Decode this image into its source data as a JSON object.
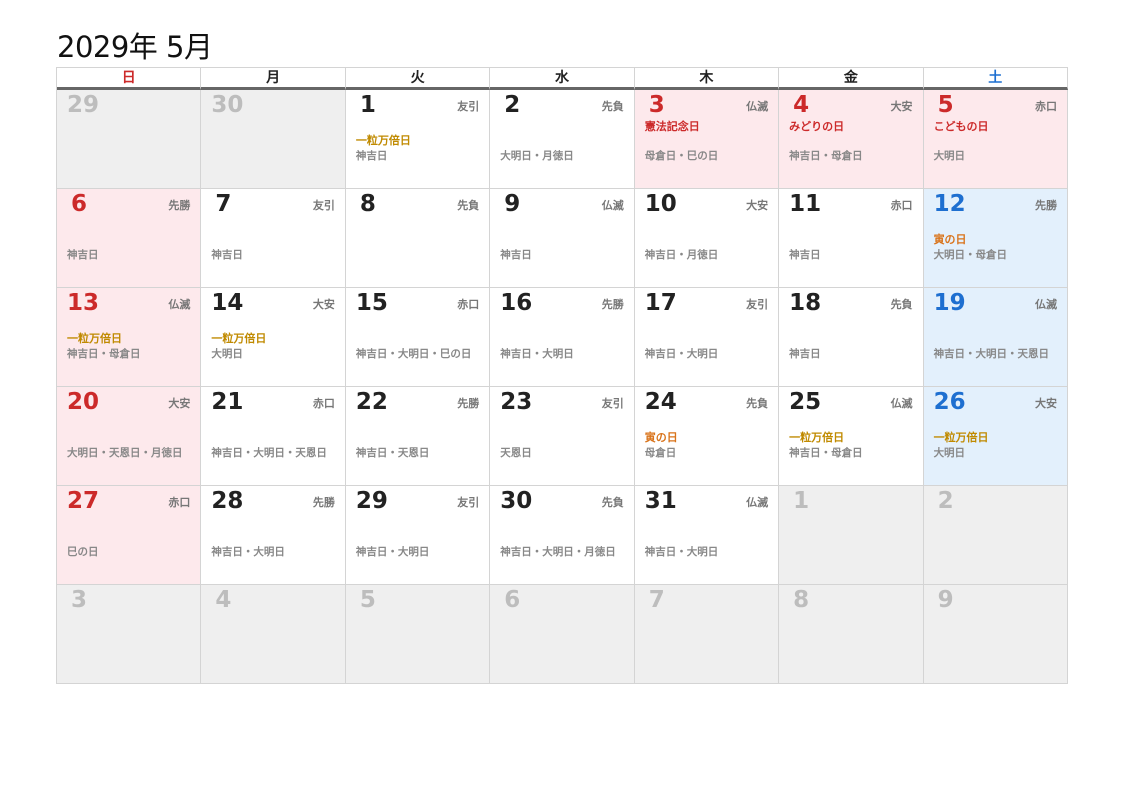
{
  "title": "2029年 5月",
  "weekdays": [
    "日",
    "月",
    "火",
    "水",
    "木",
    "金",
    "土"
  ],
  "colors": {
    "sunday": "#cc2a2a",
    "saturday": "#1e6fd0",
    "holiday_bg": "#fde9ec",
    "saturday_bg": "#e3f0fc",
    "other_month_bg": "#efefef",
    "ichiryu": "#c08a00",
    "tora": "#d9731a"
  },
  "weeks": [
    [
      {
        "day": "29",
        "rokuyo": "",
        "event": "",
        "notes": "",
        "kind": "other"
      },
      {
        "day": "30",
        "rokuyo": "",
        "event": "",
        "notes": "",
        "kind": "other"
      },
      {
        "day": "1",
        "rokuyo": "友引",
        "event": "一粒万倍日",
        "event_type": "gold",
        "notes": "神吉日",
        "kind": "normal"
      },
      {
        "day": "2",
        "rokuyo": "先負",
        "event": "",
        "notes": "大明日・月徳日",
        "kind": "normal"
      },
      {
        "day": "3",
        "rokuyo": "仏滅",
        "event": "憲法記念日",
        "event_type": "hname",
        "notes": "母倉日・巳の日",
        "kind": "holiday"
      },
      {
        "day": "4",
        "rokuyo": "大安",
        "event": "みどりの日",
        "event_type": "hname",
        "notes": "神吉日・母倉日",
        "kind": "holiday"
      },
      {
        "day": "5",
        "rokuyo": "赤口",
        "event": "こどもの日",
        "event_type": "hname",
        "notes": "大明日",
        "kind": "holiday"
      }
    ],
    [
      {
        "day": "6",
        "rokuyo": "先勝",
        "event": "",
        "notes": "神吉日",
        "kind": "holiday"
      },
      {
        "day": "7",
        "rokuyo": "友引",
        "event": "",
        "notes": "神吉日",
        "kind": "normal"
      },
      {
        "day": "8",
        "rokuyo": "先負",
        "event": "",
        "notes": "",
        "kind": "normal"
      },
      {
        "day": "9",
        "rokuyo": "仏滅",
        "event": "",
        "notes": "神吉日",
        "kind": "normal"
      },
      {
        "day": "10",
        "rokuyo": "大安",
        "event": "",
        "notes": "神吉日・月徳日",
        "kind": "normal"
      },
      {
        "day": "11",
        "rokuyo": "赤口",
        "event": "",
        "notes": "神吉日",
        "kind": "normal"
      },
      {
        "day": "12",
        "rokuyo": "先勝",
        "event": "寅の日",
        "event_type": "tora",
        "notes": "大明日・母倉日",
        "kind": "sat"
      }
    ],
    [
      {
        "day": "13",
        "rokuyo": "仏滅",
        "event": "一粒万倍日",
        "event_type": "gold",
        "notes": "神吉日・母倉日",
        "kind": "sun"
      },
      {
        "day": "14",
        "rokuyo": "大安",
        "event": "一粒万倍日",
        "event_type": "gold",
        "notes": "大明日",
        "kind": "normal"
      },
      {
        "day": "15",
        "rokuyo": "赤口",
        "event": "",
        "notes": "神吉日・大明日・巳の日",
        "kind": "normal"
      },
      {
        "day": "16",
        "rokuyo": "先勝",
        "event": "",
        "notes": "神吉日・大明日",
        "kind": "normal"
      },
      {
        "day": "17",
        "rokuyo": "友引",
        "event": "",
        "notes": "神吉日・大明日",
        "kind": "normal"
      },
      {
        "day": "18",
        "rokuyo": "先負",
        "event": "",
        "notes": "神吉日",
        "kind": "normal"
      },
      {
        "day": "19",
        "rokuyo": "仏滅",
        "event": "",
        "notes": "神吉日・大明日・天恩日",
        "kind": "sat"
      }
    ],
    [
      {
        "day": "20",
        "rokuyo": "大安",
        "event": "",
        "notes": "大明日・天恩日・月徳日",
        "kind": "sun"
      },
      {
        "day": "21",
        "rokuyo": "赤口",
        "event": "",
        "notes": "神吉日・大明日・天恩日",
        "kind": "normal"
      },
      {
        "day": "22",
        "rokuyo": "先勝",
        "event": "",
        "notes": "神吉日・天恩日",
        "kind": "normal"
      },
      {
        "day": "23",
        "rokuyo": "友引",
        "event": "",
        "notes": "天恩日",
        "kind": "normal"
      },
      {
        "day": "24",
        "rokuyo": "先負",
        "event": "寅の日",
        "event_type": "tora",
        "notes": "母倉日",
        "kind": "normal"
      },
      {
        "day": "25",
        "rokuyo": "仏滅",
        "event": "一粒万倍日",
        "event_type": "gold",
        "notes": "神吉日・母倉日",
        "kind": "normal"
      },
      {
        "day": "26",
        "rokuyo": "大安",
        "event": "一粒万倍日",
        "event_type": "gold",
        "notes": "大明日",
        "kind": "sat"
      }
    ],
    [
      {
        "day": "27",
        "rokuyo": "赤口",
        "event": "",
        "notes": "巳の日",
        "kind": "sun"
      },
      {
        "day": "28",
        "rokuyo": "先勝",
        "event": "",
        "notes": "神吉日・大明日",
        "kind": "normal"
      },
      {
        "day": "29",
        "rokuyo": "友引",
        "event": "",
        "notes": "神吉日・大明日",
        "kind": "normal"
      },
      {
        "day": "30",
        "rokuyo": "先負",
        "event": "",
        "notes": "神吉日・大明日・月徳日",
        "kind": "normal"
      },
      {
        "day": "31",
        "rokuyo": "仏滅",
        "event": "",
        "notes": "神吉日・大明日",
        "kind": "normal"
      },
      {
        "day": "1",
        "rokuyo": "",
        "event": "",
        "notes": "",
        "kind": "other"
      },
      {
        "day": "2",
        "rokuyo": "",
        "event": "",
        "notes": "",
        "kind": "other"
      }
    ],
    [
      {
        "day": "3",
        "rokuyo": "",
        "event": "",
        "notes": "",
        "kind": "other"
      },
      {
        "day": "4",
        "rokuyo": "",
        "event": "",
        "notes": "",
        "kind": "other"
      },
      {
        "day": "5",
        "rokuyo": "",
        "event": "",
        "notes": "",
        "kind": "other"
      },
      {
        "day": "6",
        "rokuyo": "",
        "event": "",
        "notes": "",
        "kind": "other"
      },
      {
        "day": "7",
        "rokuyo": "",
        "event": "",
        "notes": "",
        "kind": "other"
      },
      {
        "day": "8",
        "rokuyo": "",
        "event": "",
        "notes": "",
        "kind": "other"
      },
      {
        "day": "9",
        "rokuyo": "",
        "event": "",
        "notes": "",
        "kind": "other"
      }
    ]
  ]
}
